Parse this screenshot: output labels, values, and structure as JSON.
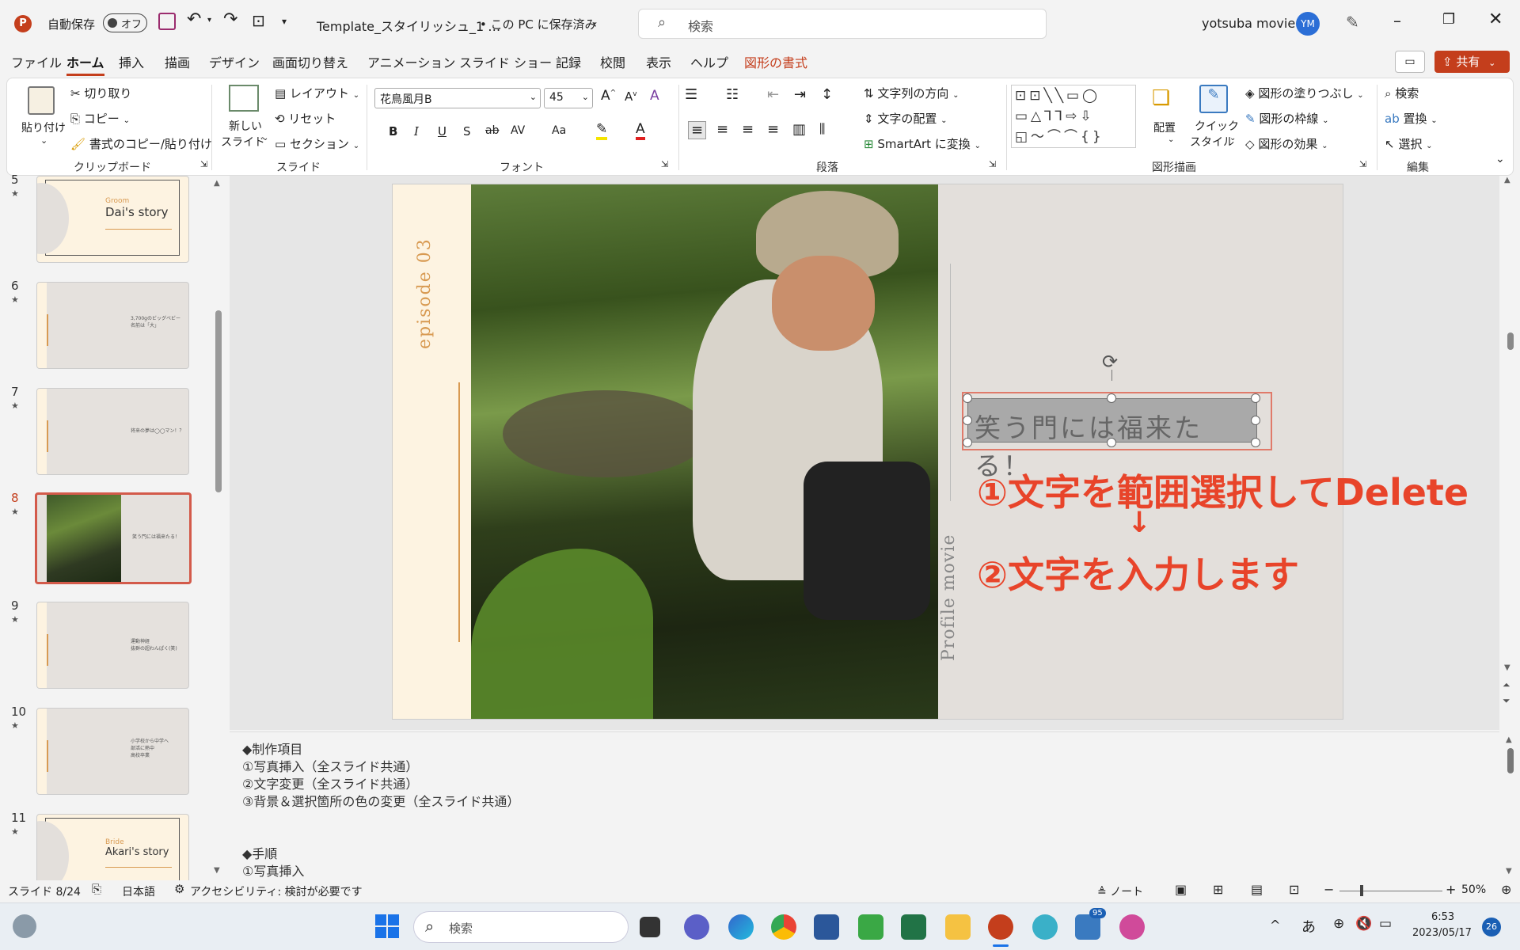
{
  "titlebar": {
    "autosave": "自動保存",
    "toggle": "オフ",
    "doc_title": "Template_スタイリッシュ_1 …",
    "save_status": "• この PC に保存済み",
    "search_placeholder": "検索",
    "user_name": "yotsuba movie",
    "avatar": "YM"
  },
  "tabs": [
    "ファイル",
    "ホーム",
    "挿入",
    "描画",
    "デザイン",
    "画面切り替え",
    "アニメーション",
    "スライド ショー",
    "記録",
    "校閲",
    "表示",
    "ヘルプ",
    "図形の書式"
  ],
  "share_label": "共有",
  "ribbon": {
    "clipboard": {
      "paste": "貼り付け",
      "cut": "切り取り",
      "copy": "コピー",
      "format_painter": "書式のコピー/貼り付け",
      "group": "クリップボード"
    },
    "slides": {
      "new_slide_1": "新しい",
      "new_slide_2": "スライド",
      "layout": "レイアウト",
      "reset": "リセット",
      "section": "セクション",
      "group": "スライド"
    },
    "font": {
      "font_name": "花鳥風月B",
      "font_size": "45",
      "bold": "B",
      "italic": "I",
      "underline": "U",
      "shadow": "S",
      "strike": "ab",
      "spacing": "AV",
      "case": "Aa",
      "group": "フォント"
    },
    "paragraph": {
      "text_direction": "文字列の方向",
      "align_text": "文字の配置",
      "smartart": "SmartArt に変換",
      "group": "段落"
    },
    "drawing": {
      "arrange": "配置",
      "quick_styles_1": "クイック",
      "quick_styles_2": "スタイル",
      "fill": "図形の塗りつぶし",
      "outline": "図形の枠線",
      "effects": "図形の効果",
      "group": "図形描画"
    },
    "editing": {
      "find": "検索",
      "replace": "置換",
      "select": "選択",
      "group": "編集"
    }
  },
  "thumbnails": [
    {
      "num": "5",
      "title": "Dai's story",
      "sub": "Groom",
      "selected": false
    },
    {
      "num": "6",
      "text": "3,700gのビッグベビー\n名前は「大」",
      "selected": false
    },
    {
      "num": "7",
      "text": "将来の夢は◯◯マン！？",
      "selected": false
    },
    {
      "num": "8",
      "text": "笑う門には福来たる！",
      "selected": true
    },
    {
      "num": "9",
      "text": "運動神経\n抜群の超わんぱく(笑)",
      "selected": false
    },
    {
      "num": "10",
      "text": "小学校から中学へ\n部活に熱中\n高校卒業",
      "selected": false
    },
    {
      "num": "11",
      "title": "Akari's story",
      "sub": "Bride",
      "selected": false
    }
  ],
  "slide": {
    "episode": "episode 03",
    "textbox": "笑う門には福来たる！",
    "side_label": "Profile movie"
  },
  "annotation": {
    "step1": "①文字を範囲選択してDelete",
    "arrow": "↓",
    "step2": "②文字を入力します",
    "color": "#e8442a"
  },
  "notes": [
    "◆制作項目",
    "①写真挿入（全スライド共通）",
    "②文字変更（全スライド共通）",
    "③背景＆選択箇所の色の変更（全スライド共通）",
    "",
    "◆手順",
    "①写真挿入"
  ],
  "status": {
    "slide": "スライド 8/24",
    "language": "日本語",
    "accessibility": "アクセシビリティ: 検討が必要です",
    "notes_btn": "ノート",
    "zoom": "50%"
  },
  "taskbar": {
    "search": "検索",
    "time": "6:53",
    "date": "2023/05/17",
    "ime": "あ",
    "mail_badge": "95",
    "notif": "26"
  },
  "colors": {
    "accent": "#c43e1c",
    "select": "#d35a4a",
    "slide_bg": "#e3dfdb",
    "cream": "#fdf3e1",
    "orange": "#d89a52"
  }
}
